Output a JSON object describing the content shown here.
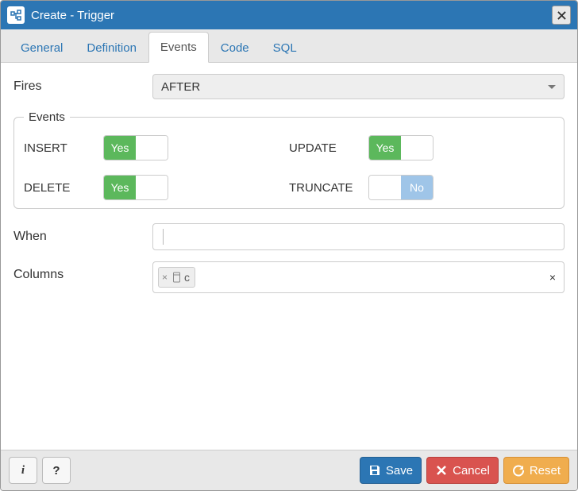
{
  "title": "Create - Trigger",
  "tabs": [
    {
      "label": "General",
      "active": false
    },
    {
      "label": "Definition",
      "active": false
    },
    {
      "label": "Events",
      "active": true
    },
    {
      "label": "Code",
      "active": false
    },
    {
      "label": "SQL",
      "active": false
    }
  ],
  "fires": {
    "label": "Fires",
    "value": "AFTER"
  },
  "events_group_label": "Events",
  "events": {
    "insert": {
      "label": "INSERT",
      "value": true,
      "text": "Yes"
    },
    "update": {
      "label": "UPDATE",
      "value": true,
      "text": "Yes"
    },
    "delete": {
      "label": "DELETE",
      "value": true,
      "text": "Yes"
    },
    "truncate": {
      "label": "TRUNCATE",
      "value": false,
      "text": "No"
    }
  },
  "when": {
    "label": "When",
    "value": ""
  },
  "columns": {
    "label": "Columns",
    "tags": [
      {
        "name": "c"
      }
    ]
  },
  "footer": {
    "info_label": "i",
    "help_label": "?",
    "save": "Save",
    "cancel": "Cancel",
    "reset": "Reset"
  }
}
